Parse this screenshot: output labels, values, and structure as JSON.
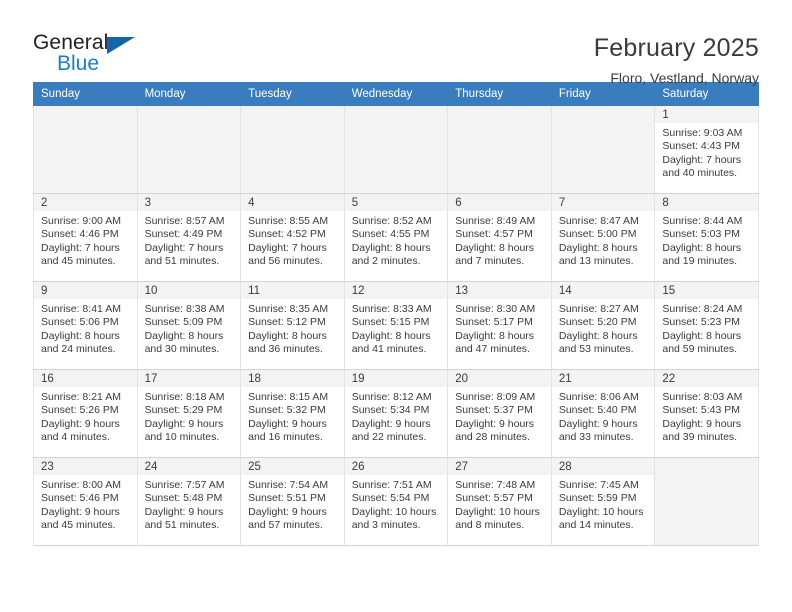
{
  "brand": {
    "name_part1": "General",
    "name_part2": "Blue",
    "accent_color": "#1b7dd0",
    "triangle_color": "#1465ab"
  },
  "header": {
    "title": "February 2025",
    "subtitle": "Floro, Vestland, Norway"
  },
  "calendar": {
    "header_bg": "#3a7dbf",
    "weekdays": [
      "Sunday",
      "Monday",
      "Tuesday",
      "Wednesday",
      "Thursday",
      "Friday",
      "Saturday"
    ],
    "weeks": [
      [
        {
          "day": "",
          "lines": []
        },
        {
          "day": "",
          "lines": []
        },
        {
          "day": "",
          "lines": []
        },
        {
          "day": "",
          "lines": []
        },
        {
          "day": "",
          "lines": []
        },
        {
          "day": "",
          "lines": []
        },
        {
          "day": "1",
          "lines": [
            "Sunrise: 9:03 AM",
            "Sunset: 4:43 PM",
            "Daylight: 7 hours",
            "and 40 minutes."
          ]
        }
      ],
      [
        {
          "day": "2",
          "lines": [
            "Sunrise: 9:00 AM",
            "Sunset: 4:46 PM",
            "Daylight: 7 hours",
            "and 45 minutes."
          ]
        },
        {
          "day": "3",
          "lines": [
            "Sunrise: 8:57 AM",
            "Sunset: 4:49 PM",
            "Daylight: 7 hours",
            "and 51 minutes."
          ]
        },
        {
          "day": "4",
          "lines": [
            "Sunrise: 8:55 AM",
            "Sunset: 4:52 PM",
            "Daylight: 7 hours",
            "and 56 minutes."
          ]
        },
        {
          "day": "5",
          "lines": [
            "Sunrise: 8:52 AM",
            "Sunset: 4:55 PM",
            "Daylight: 8 hours",
            "and 2 minutes."
          ]
        },
        {
          "day": "6",
          "lines": [
            "Sunrise: 8:49 AM",
            "Sunset: 4:57 PM",
            "Daylight: 8 hours",
            "and 7 minutes."
          ]
        },
        {
          "day": "7",
          "lines": [
            "Sunrise: 8:47 AM",
            "Sunset: 5:00 PM",
            "Daylight: 8 hours",
            "and 13 minutes."
          ]
        },
        {
          "day": "8",
          "lines": [
            "Sunrise: 8:44 AM",
            "Sunset: 5:03 PM",
            "Daylight: 8 hours",
            "and 19 minutes."
          ]
        }
      ],
      [
        {
          "day": "9",
          "lines": [
            "Sunrise: 8:41 AM",
            "Sunset: 5:06 PM",
            "Daylight: 8 hours",
            "and 24 minutes."
          ]
        },
        {
          "day": "10",
          "lines": [
            "Sunrise: 8:38 AM",
            "Sunset: 5:09 PM",
            "Daylight: 8 hours",
            "and 30 minutes."
          ]
        },
        {
          "day": "11",
          "lines": [
            "Sunrise: 8:35 AM",
            "Sunset: 5:12 PM",
            "Daylight: 8 hours",
            "and 36 minutes."
          ]
        },
        {
          "day": "12",
          "lines": [
            "Sunrise: 8:33 AM",
            "Sunset: 5:15 PM",
            "Daylight: 8 hours",
            "and 41 minutes."
          ]
        },
        {
          "day": "13",
          "lines": [
            "Sunrise: 8:30 AM",
            "Sunset: 5:17 PM",
            "Daylight: 8 hours",
            "and 47 minutes."
          ]
        },
        {
          "day": "14",
          "lines": [
            "Sunrise: 8:27 AM",
            "Sunset: 5:20 PM",
            "Daylight: 8 hours",
            "and 53 minutes."
          ]
        },
        {
          "day": "15",
          "lines": [
            "Sunrise: 8:24 AM",
            "Sunset: 5:23 PM",
            "Daylight: 8 hours",
            "and 59 minutes."
          ]
        }
      ],
      [
        {
          "day": "16",
          "lines": [
            "Sunrise: 8:21 AM",
            "Sunset: 5:26 PM",
            "Daylight: 9 hours",
            "and 4 minutes."
          ]
        },
        {
          "day": "17",
          "lines": [
            "Sunrise: 8:18 AM",
            "Sunset: 5:29 PM",
            "Daylight: 9 hours",
            "and 10 minutes."
          ]
        },
        {
          "day": "18",
          "lines": [
            "Sunrise: 8:15 AM",
            "Sunset: 5:32 PM",
            "Daylight: 9 hours",
            "and 16 minutes."
          ]
        },
        {
          "day": "19",
          "lines": [
            "Sunrise: 8:12 AM",
            "Sunset: 5:34 PM",
            "Daylight: 9 hours",
            "and 22 minutes."
          ]
        },
        {
          "day": "20",
          "lines": [
            "Sunrise: 8:09 AM",
            "Sunset: 5:37 PM",
            "Daylight: 9 hours",
            "and 28 minutes."
          ]
        },
        {
          "day": "21",
          "lines": [
            "Sunrise: 8:06 AM",
            "Sunset: 5:40 PM",
            "Daylight: 9 hours",
            "and 33 minutes."
          ]
        },
        {
          "day": "22",
          "lines": [
            "Sunrise: 8:03 AM",
            "Sunset: 5:43 PM",
            "Daylight: 9 hours",
            "and 39 minutes."
          ]
        }
      ],
      [
        {
          "day": "23",
          "lines": [
            "Sunrise: 8:00 AM",
            "Sunset: 5:46 PM",
            "Daylight: 9 hours",
            "and 45 minutes."
          ]
        },
        {
          "day": "24",
          "lines": [
            "Sunrise: 7:57 AM",
            "Sunset: 5:48 PM",
            "Daylight: 9 hours",
            "and 51 minutes."
          ]
        },
        {
          "day": "25",
          "lines": [
            "Sunrise: 7:54 AM",
            "Sunset: 5:51 PM",
            "Daylight: 9 hours",
            "and 57 minutes."
          ]
        },
        {
          "day": "26",
          "lines": [
            "Sunrise: 7:51 AM",
            "Sunset: 5:54 PM",
            "Daylight: 10 hours",
            "and 3 minutes."
          ]
        },
        {
          "day": "27",
          "lines": [
            "Sunrise: 7:48 AM",
            "Sunset: 5:57 PM",
            "Daylight: 10 hours",
            "and 8 minutes."
          ]
        },
        {
          "day": "28",
          "lines": [
            "Sunrise: 7:45 AM",
            "Sunset: 5:59 PM",
            "Daylight: 10 hours",
            "and 14 minutes."
          ]
        },
        {
          "day": "",
          "lines": []
        }
      ]
    ]
  }
}
